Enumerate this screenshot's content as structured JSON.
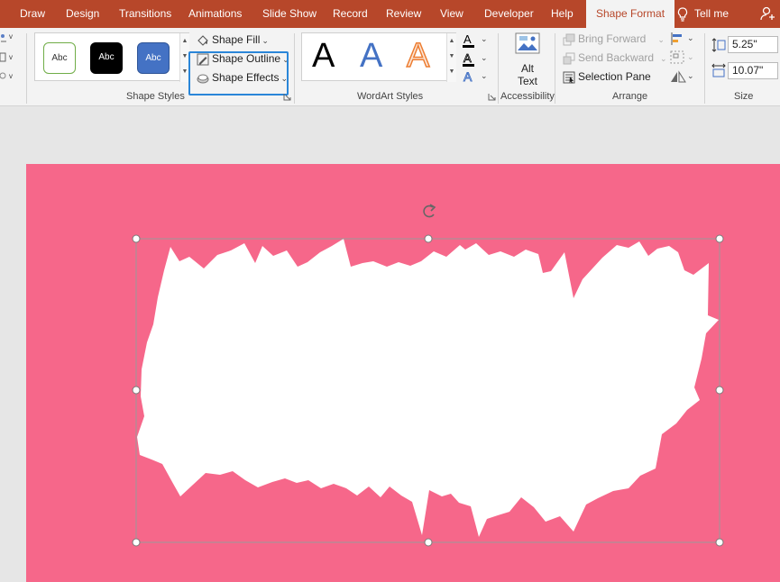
{
  "tabs": {
    "draw": "Draw",
    "design": "Design",
    "transitions": "Transitions",
    "animations": "Animations",
    "slideshow": "Slide Show",
    "record": "Record",
    "review": "Review",
    "view": "View",
    "developer": "Developer",
    "help": "Help",
    "shape_format": "Shape Format",
    "tell_me": "Tell me"
  },
  "shape_styles": {
    "group_label": "Shape Styles",
    "preset_1": "Abc",
    "preset_2": "Abc",
    "preset_3": "Abc",
    "shape_fill": "Shape Fill",
    "shape_outline": "Shape Outline",
    "shape_effects": "Shape Effects"
  },
  "wordart": {
    "group_label": "WordArt Styles",
    "letter_1": "A",
    "letter_2": "A",
    "letter_3": "A"
  },
  "accessibility": {
    "group_label": "Accessibility",
    "alt_text_line1": "Alt",
    "alt_text_line2": "Text"
  },
  "arrange": {
    "group_label": "Arrange",
    "bring_forward": "Bring Forward",
    "send_backward": "Send Backward",
    "selection_pane": "Selection Pane"
  },
  "size": {
    "group_label": "Size",
    "height": "5.25\"",
    "width": "10.07\""
  },
  "colors": {
    "accent": "#b7472a",
    "slide_background": "#f6678a",
    "highlight": "#2a86d8"
  }
}
